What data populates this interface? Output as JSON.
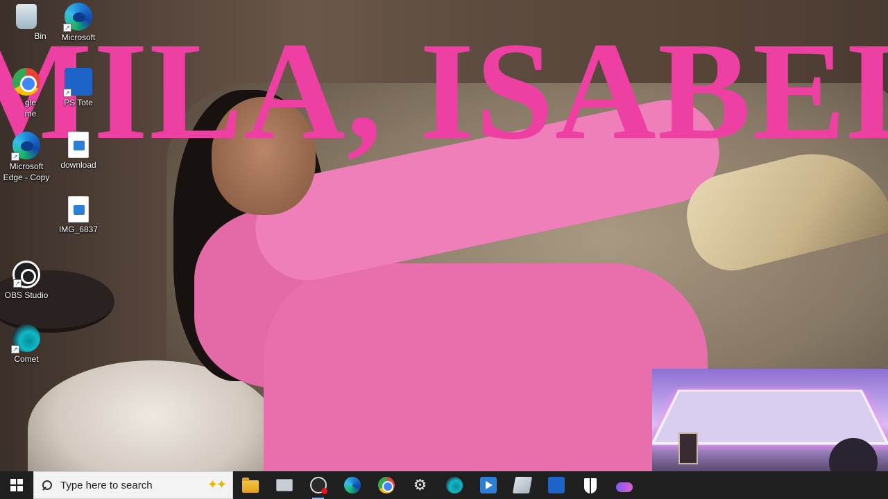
{
  "wallpaper": {
    "headline": "MILA, ISABEL"
  },
  "desktop": {
    "icons": [
      {
        "label": "Recycle Bin",
        "visible_label": "Bin",
        "icon": "recycle-bin-icon"
      },
      {
        "label": "Microsoft",
        "visible_label": "Microsoft",
        "icon": "edge-icon"
      },
      {
        "label": "Google Chrome",
        "visible_label": "gle\nme",
        "icon": "chrome-icon"
      },
      {
        "label": "Photoshop",
        "visible_label": "PS Tote",
        "icon": "photoshop-icon"
      },
      {
        "label": "Microsoft Edge - Copy",
        "visible_label": "Microsoft Edge - Copy",
        "icon": "edge-icon"
      },
      {
        "label": "download",
        "visible_label": "download",
        "icon": "image-file-icon"
      },
      {
        "label": "IMG_6837",
        "visible_label": "IMG_6837",
        "icon": "video-file-icon"
      },
      {
        "label": "OBS Studio",
        "visible_label": "OBS Studio",
        "icon": "obs-icon"
      },
      {
        "label": "Comet",
        "visible_label": "Comet",
        "icon": "comet-icon"
      }
    ]
  },
  "taskbar": {
    "search_placeholder": "Type here to search",
    "apps": [
      {
        "name": "file-explorer",
        "icon": "folder-icon"
      },
      {
        "name": "file-manager",
        "icon": "files-icon"
      },
      {
        "name": "obs-recording",
        "icon": "obs-icon"
      },
      {
        "name": "microsoft-edge",
        "icon": "edge-icon"
      },
      {
        "name": "google-chrome",
        "icon": "chrome-icon"
      },
      {
        "name": "settings",
        "icon": "gear-icon"
      },
      {
        "name": "comet",
        "icon": "comet-icon"
      },
      {
        "name": "media-player",
        "icon": "media-icon"
      },
      {
        "name": "notes",
        "icon": "notes-icon"
      },
      {
        "name": "snipping-tool",
        "icon": "snip-icon"
      },
      {
        "name": "security",
        "icon": "shield-icon"
      },
      {
        "name": "game-bar",
        "icon": "gamepad-icon"
      }
    ]
  }
}
